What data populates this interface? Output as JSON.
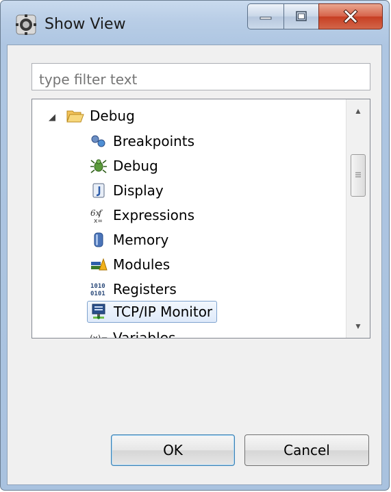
{
  "window": {
    "title": "Show View",
    "icon": "eclipse-icon"
  },
  "controls": {
    "minimize": "minimize-icon",
    "maximize": "maximize-icon",
    "close": "close-icon"
  },
  "filter": {
    "placeholder": "type filter text",
    "value": ""
  },
  "tree": {
    "category": {
      "label": "Debug",
      "icon": "folder-open-icon",
      "expanded": true
    },
    "items": [
      {
        "label": "Breakpoints",
        "icon": "breakpoints-icon"
      },
      {
        "label": "Debug",
        "icon": "bug-icon"
      },
      {
        "label": "Display",
        "icon": "display-icon"
      },
      {
        "label": "Expressions",
        "icon": "expressions-icon"
      },
      {
        "label": "Memory",
        "icon": "memory-icon"
      },
      {
        "label": "Modules",
        "icon": "modules-icon"
      },
      {
        "label": "Registers",
        "icon": "registers-icon"
      },
      {
        "label": "TCP/IP Monitor",
        "icon": "tcpip-monitor-icon",
        "selected": true
      },
      {
        "label": "Variables",
        "icon": "variables-icon"
      }
    ]
  },
  "buttons": {
    "ok": "OK",
    "cancel": "Cancel"
  },
  "colors": {
    "selection_border": "#7da2ce",
    "title_bar": "#b8cde6",
    "close_button": "#c73e22"
  }
}
